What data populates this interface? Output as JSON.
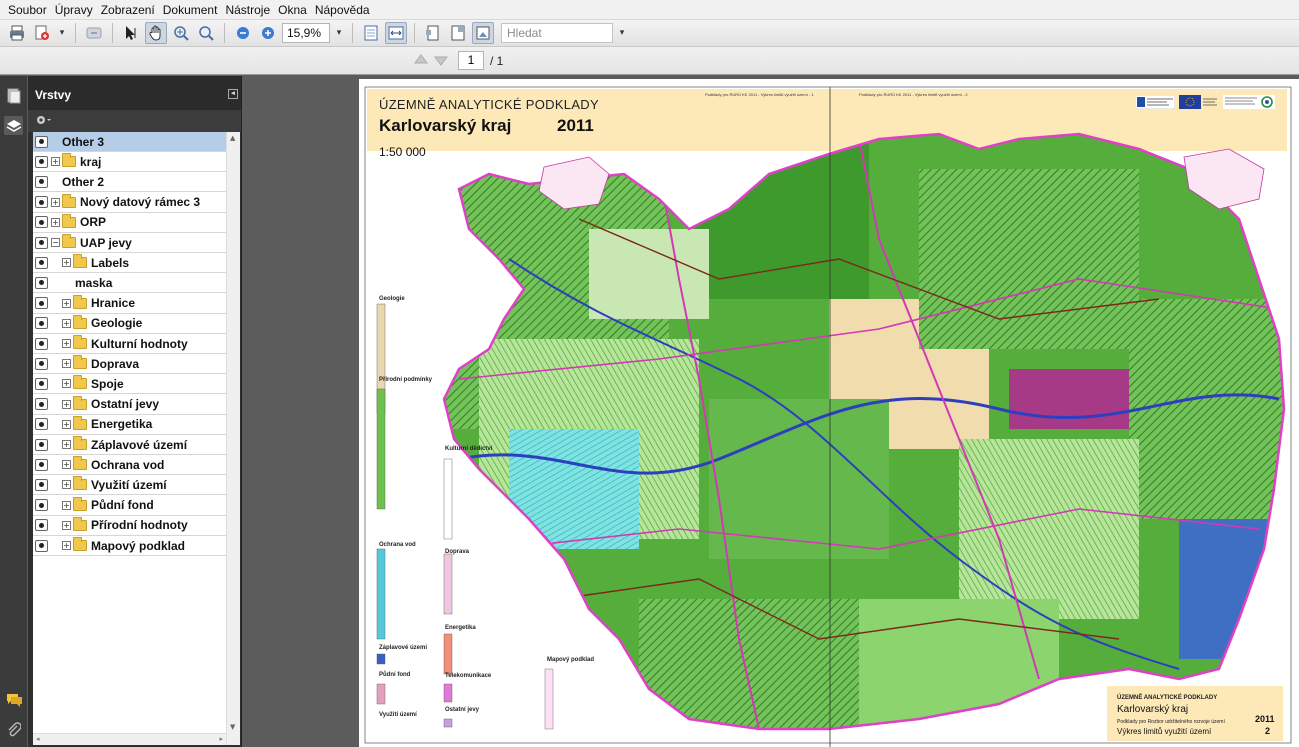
{
  "menu": [
    "Soubor",
    "Úpravy",
    "Zobrazení",
    "Dokument",
    "Nástroje",
    "Okna",
    "Nápověda"
  ],
  "toolbar": {
    "zoom_value": "15,9%",
    "search_placeholder": "Hledat",
    "icons": [
      "print-icon",
      "export-icon",
      "undo-icon",
      "select-tool-icon",
      "hand-tool-icon",
      "zoom-marquee-icon",
      "zoom-in-icon",
      "zoom-out-minus-icon",
      "zoom-plus-icon",
      "fit-page-icon",
      "fit-width-icon",
      "page-setup-icon",
      "layers-view-icon",
      "snapshot-icon"
    ]
  },
  "navigation": {
    "current_page": "1",
    "total_pages": "/ 1"
  },
  "layers_panel": {
    "title": "Vrstvy",
    "options_icon": "gear-icon",
    "items": [
      {
        "label": "Other 3",
        "indent": 0,
        "expander": "",
        "folder": false,
        "selected": true
      },
      {
        "label": "kraj",
        "indent": 0,
        "expander": "+",
        "folder": true,
        "selected": false
      },
      {
        "label": "Other 2",
        "indent": 0,
        "expander": "",
        "folder": false,
        "selected": false
      },
      {
        "label": "Nový datový rámec 3",
        "indent": 0,
        "expander": "+",
        "folder": true,
        "selected": false
      },
      {
        "label": "ORP",
        "indent": 0,
        "expander": "+",
        "folder": true,
        "selected": false
      },
      {
        "label": "UAP jevy",
        "indent": 0,
        "expander": "−",
        "folder": true,
        "selected": false
      },
      {
        "label": "Labels",
        "indent": 1,
        "expander": "+",
        "folder": true,
        "selected": false
      },
      {
        "label": "maska",
        "indent": 1,
        "expander": "",
        "folder": false,
        "selected": false
      },
      {
        "label": "Hranice",
        "indent": 1,
        "expander": "+",
        "folder": true,
        "selected": false
      },
      {
        "label": "Geologie",
        "indent": 1,
        "expander": "+",
        "folder": true,
        "selected": false
      },
      {
        "label": "Kulturní hodnoty",
        "indent": 1,
        "expander": "+",
        "folder": true,
        "selected": false
      },
      {
        "label": "Doprava",
        "indent": 1,
        "expander": "+",
        "folder": true,
        "selected": false
      },
      {
        "label": "Spoje",
        "indent": 1,
        "expander": "+",
        "folder": true,
        "selected": false
      },
      {
        "label": "Ostatní jevy",
        "indent": 1,
        "expander": "+",
        "folder": true,
        "selected": false
      },
      {
        "label": "Energetika",
        "indent": 1,
        "expander": "+",
        "folder": true,
        "selected": false
      },
      {
        "label": "Záplavové území",
        "indent": 1,
        "expander": "+",
        "folder": true,
        "selected": false
      },
      {
        "label": "Ochrana vod",
        "indent": 1,
        "expander": "+",
        "folder": true,
        "selected": false
      },
      {
        "label": "Využití území",
        "indent": 1,
        "expander": "+",
        "folder": true,
        "selected": false
      },
      {
        "label": "Půdní fond",
        "indent": 1,
        "expander": "+",
        "folder": true,
        "selected": false
      },
      {
        "label": "Přírodní hodnoty",
        "indent": 1,
        "expander": "+",
        "folder": true,
        "selected": false
      },
      {
        "label": "Mapový podklad",
        "indent": 1,
        "expander": "+",
        "folder": true,
        "selected": false
      }
    ]
  },
  "document": {
    "overtitle": "ÚZEMNĚ ANALYTICKÉ PODKLADY",
    "title": "Karlovarský kraj",
    "year": "2011",
    "scale": "1:50 000",
    "header_left": "Podklady pro RURÚ KK 2011 - Výkres limitů využití území - 1",
    "header_right": "Podklady pro RURÚ KK 2011 - Výkres limitů využití území - 2",
    "legend_sections": [
      "Geologie",
      "Přírodní podmínky",
      "Kulturní dědictví",
      "Ochrana vod",
      "Doprava",
      "Energetika",
      "Záplavové území",
      "Půdní fond",
      "Telekomunikace",
      "Ostatní jevy",
      "Využití území",
      "Mapový podklad"
    ],
    "stamp": {
      "overtitle": "ÚZEMNĚ ANALYTICKÉ PODKLADY",
      "region": "Karlovarský kraj",
      "subtitle": "Podklady pro Rozbor udržitelného rozvoje území",
      "drawing": "Výkres limitů využití území",
      "year": "2011",
      "sheet": "2"
    },
    "colors": {
      "forest_green": "#3e9a2e",
      "light_green": "#8fd06b",
      "border_magenta": "#e040c8",
      "water_cyan": "#4fd4d6",
      "title_band": "#fde9b8"
    }
  }
}
